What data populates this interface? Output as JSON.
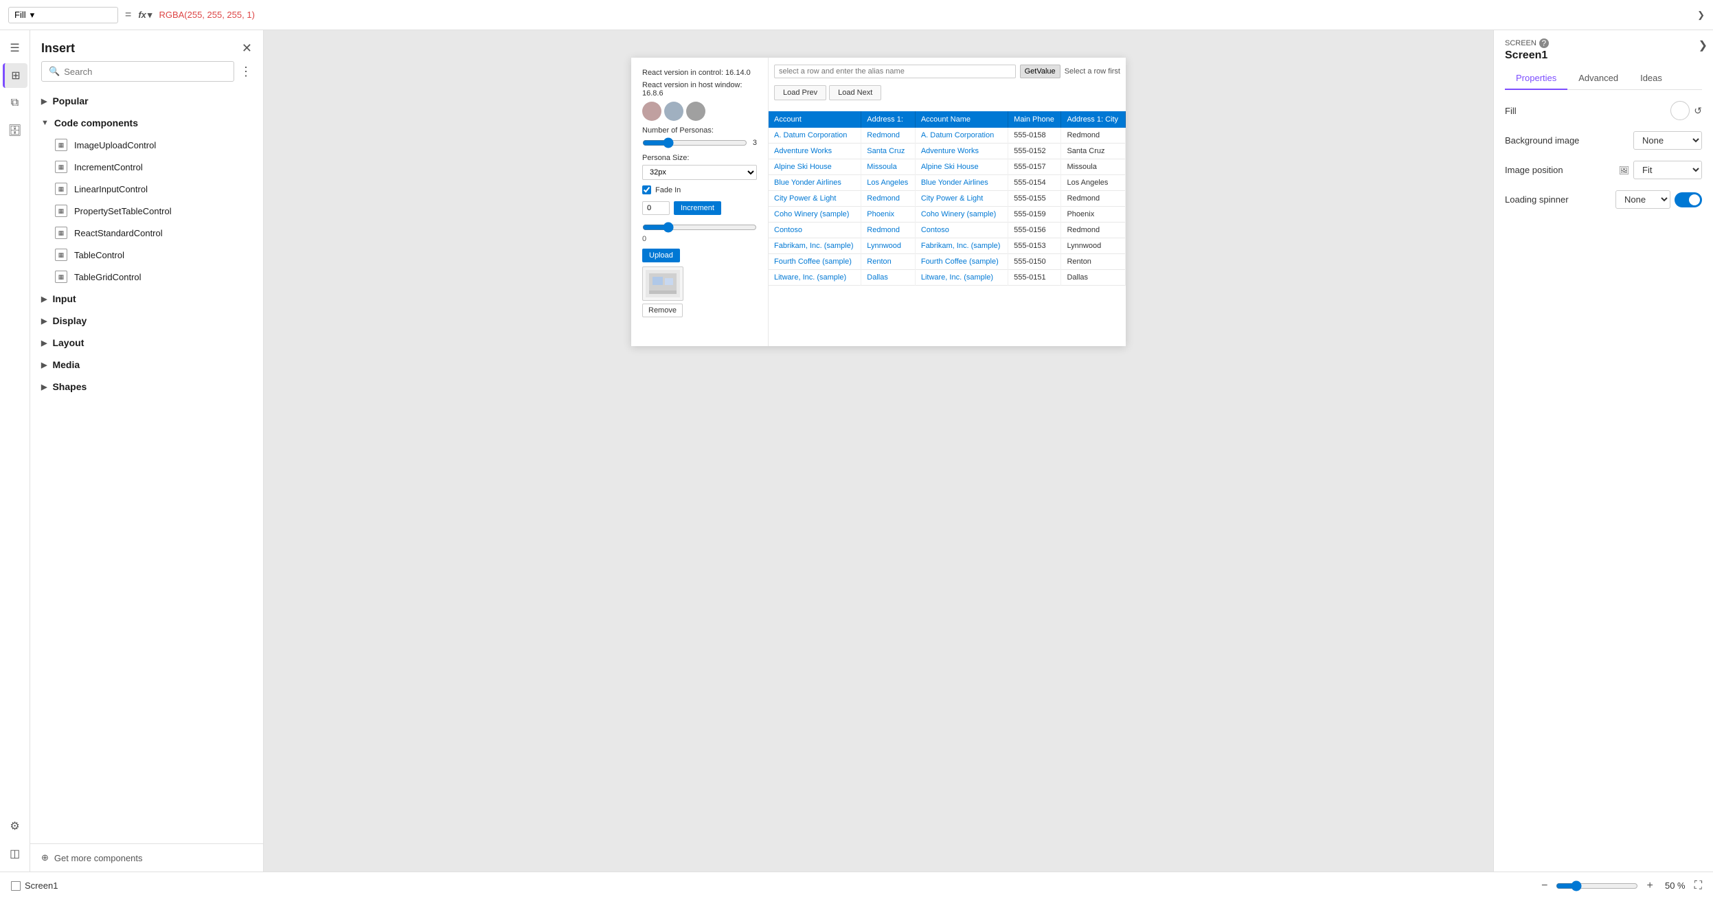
{
  "topBar": {
    "fillLabel": "Fill",
    "equalsSymbol": "=",
    "fxLabel": "fx",
    "formulaValue": "RGBA(255, 255, 255, 1)"
  },
  "insertPanel": {
    "title": "Insert",
    "searchPlaceholder": "Search",
    "categories": [
      {
        "id": "popular",
        "label": "Popular",
        "expanded": false,
        "items": []
      },
      {
        "id": "code-components",
        "label": "Code components",
        "expanded": true,
        "items": [
          "ImageUploadControl",
          "IncrementControl",
          "LinearInputControl",
          "PropertySetTableControl",
          "ReactStandardControl",
          "TableControl",
          "TableGridControl"
        ]
      },
      {
        "id": "input",
        "label": "Input",
        "expanded": false,
        "items": []
      },
      {
        "id": "display",
        "label": "Display",
        "expanded": false,
        "items": []
      },
      {
        "id": "layout",
        "label": "Layout",
        "expanded": false,
        "items": []
      },
      {
        "id": "media",
        "label": "Media",
        "expanded": false,
        "items": []
      },
      {
        "id": "shapes",
        "label": "Shapes",
        "expanded": false,
        "items": []
      }
    ],
    "getMoreLabel": "Get more components"
  },
  "appPreview": {
    "reactVersionControl": "React version in control: 16.14.0",
    "reactVersionHost": "React version in host window: 16.8.6",
    "aliasInputPlaceholder": "select a row and enter the alias name",
    "getValueBtn": "GetValue",
    "selectRowHint": "Select a row first",
    "loadPrevBtn": "Load Prev",
    "loadNextBtn": "Load Next",
    "tableHeaders": [
      "Account",
      "Address 1:",
      "Account Name",
      "Main Phone",
      "Address 1: City"
    ],
    "tableRows": [
      {
        "account": "A. Datum Corporation",
        "address1": "Redmond",
        "accountName": "A. Datum Corporation",
        "phone": "555-0158",
        "city": "Redmond"
      },
      {
        "account": "Adventure Works",
        "address1": "Santa Cruz",
        "accountName": "Adventure Works",
        "phone": "555-0152",
        "city": "Santa Cruz"
      },
      {
        "account": "Alpine Ski House",
        "address1": "Missoula",
        "accountName": "Alpine Ski House",
        "phone": "555-0157",
        "city": "Missoula"
      },
      {
        "account": "Blue Yonder Airlines",
        "address1": "Los Angeles",
        "accountName": "Blue Yonder Airlines",
        "phone": "555-0154",
        "city": "Los Angeles"
      },
      {
        "account": "City Power & Light",
        "address1": "Redmond",
        "accountName": "City Power & Light",
        "phone": "555-0155",
        "city": "Redmond"
      },
      {
        "account": "Coho Winery (sample)",
        "address1": "Phoenix",
        "accountName": "Coho Winery (sample)",
        "phone": "555-0159",
        "city": "Phoenix"
      },
      {
        "account": "Contoso",
        "address1": "Redmond",
        "accountName": "Contoso",
        "phone": "555-0156",
        "city": "Redmond"
      },
      {
        "account": "Fabrikam, Inc. (sample)",
        "address1": "Lynnwood",
        "accountName": "Fabrikam, Inc. (sample)",
        "phone": "555-0153",
        "city": "Lynnwood"
      },
      {
        "account": "Fourth Coffee (sample)",
        "address1": "Renton",
        "accountName": "Fourth Coffee (sample)",
        "phone": "555-0150",
        "city": "Renton"
      },
      {
        "account": "Litware, Inc. (sample)",
        "address1": "Dallas",
        "accountName": "Litware, Inc. (sample)",
        "phone": "555-0151",
        "city": "Dallas"
      }
    ],
    "numberOfPersonasLabel": "Number of Personas:",
    "personaSliderValue": "3",
    "personaSizeLabel": "Persona Size:",
    "personaSizeValue": "32px",
    "fadeInLabel": "Fade In",
    "incrementInputValue": "0",
    "incrementBtnLabel": "Increment",
    "sliderZeroLabel": "0",
    "uploadBtnLabel": "Upload",
    "removeBtnLabel": "Remove"
  },
  "propertiesPanel": {
    "screenLabel": "SCREEN",
    "screenName": "Screen1",
    "tabs": [
      "Properties",
      "Advanced",
      "Ideas"
    ],
    "activeTab": "Properties",
    "fillLabel": "Fill",
    "backgroundImageLabel": "Background image",
    "backgroundImageValue": "None",
    "imagePositionLabel": "Image position",
    "imagePositionValue": "Fit",
    "loadingSpinnerLabel": "Loading spinner",
    "loadingSpinnerValue": "None"
  },
  "bottomBar": {
    "screenIconLabel": "□",
    "screenName": "Screen1",
    "zoomMinus": "−",
    "zoomPlus": "+",
    "zoomPercent": "50 %"
  }
}
